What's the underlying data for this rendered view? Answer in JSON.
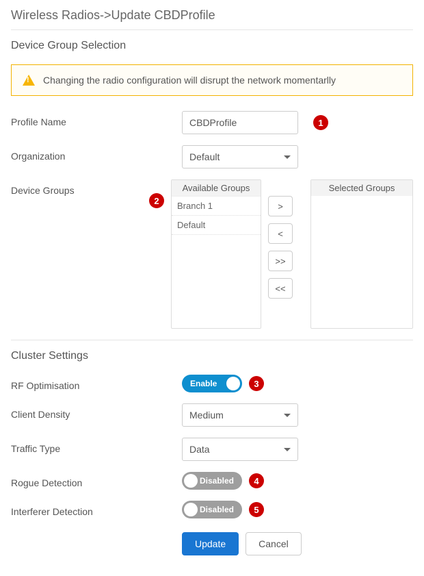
{
  "breadcrumb": "Wireless Radios->Update CBDProfile",
  "section1_title": "Device Group Selection",
  "alert_text": "Changing the radio configuration will disrupt the network momentarlly",
  "labels": {
    "profile_name": "Profile Name",
    "organization": "Organization",
    "device_groups": "Device Groups",
    "rf_optimisation": "RF Optimisation",
    "client_density": "Client Density",
    "traffic_type": "Traffic Type",
    "rogue_detection": "Rogue Detection",
    "interferer_detection": "Interferer Detection"
  },
  "profile_name_value": "CBDProfile",
  "organization_value": "Default",
  "available_header": "Available Groups",
  "selected_header": "Selected Groups",
  "available_groups": {
    "0": "Branch 1",
    "1": "Default"
  },
  "move": {
    "r": ">",
    "l": "<",
    "rr": ">>",
    "ll": "<<"
  },
  "section2_title": "Cluster Settings",
  "toggle": {
    "enable": "Enable",
    "disabled": "Disabled"
  },
  "client_density_value": "Medium",
  "traffic_type_value": "Data",
  "callouts": {
    "1": "1",
    "2": "2",
    "3": "3",
    "4": "4",
    "5": "5"
  },
  "buttons": {
    "update": "Update",
    "cancel": "Cancel"
  }
}
